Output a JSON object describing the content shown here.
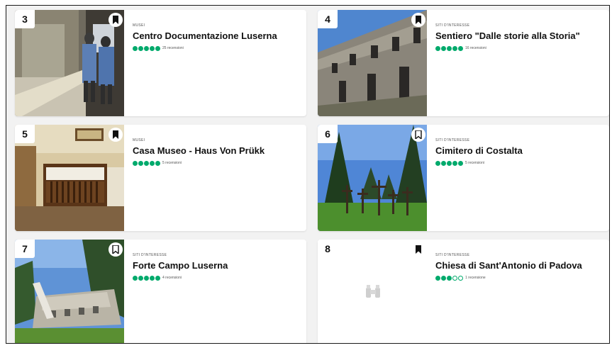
{
  "cards": [
    {
      "rank": "3",
      "category": "MUSEI",
      "name": "Centro Documentazione Luserna",
      "rating": 4.5,
      "reviews": "25 recensioni",
      "image": "museum-interior-photo"
    },
    {
      "rank": "4",
      "category": "SITI D'INTERESSE",
      "name": "Sentiero \"Dalle storie alla Storia\"",
      "rating": 5,
      "reviews": "16 recensioni",
      "image": "ruined-fort-photo"
    },
    {
      "rank": "5",
      "category": "MUSEI",
      "name": "Casa Museo - Haus Von Prükk",
      "rating": 4.5,
      "reviews": "5 recensioni",
      "image": "bedroom-crib-photo"
    },
    {
      "rank": "6",
      "category": "SITI D'INTERESSE",
      "name": "Cimitero di Costalta",
      "rating": 4.5,
      "reviews": "5 recensioni",
      "image": "cemetery-crosses-photo"
    },
    {
      "rank": "7",
      "category": "SITI D'INTERESSE",
      "name": "Forte Campo Luserna",
      "rating": 4.5,
      "reviews": "4 recensioni",
      "image": "fort-ruins-photo"
    },
    {
      "rank": "8",
      "category": "SITI D'INTERESSE",
      "name": "Chiesa di Sant'Antonio di Padova",
      "rating": 3,
      "reviews": "1 recensione",
      "image": "binoculars-placeholder-icon"
    }
  ],
  "colors": {
    "bubble": "#00aa6c",
    "background": "#f2f2f2",
    "card": "#ffffff"
  }
}
